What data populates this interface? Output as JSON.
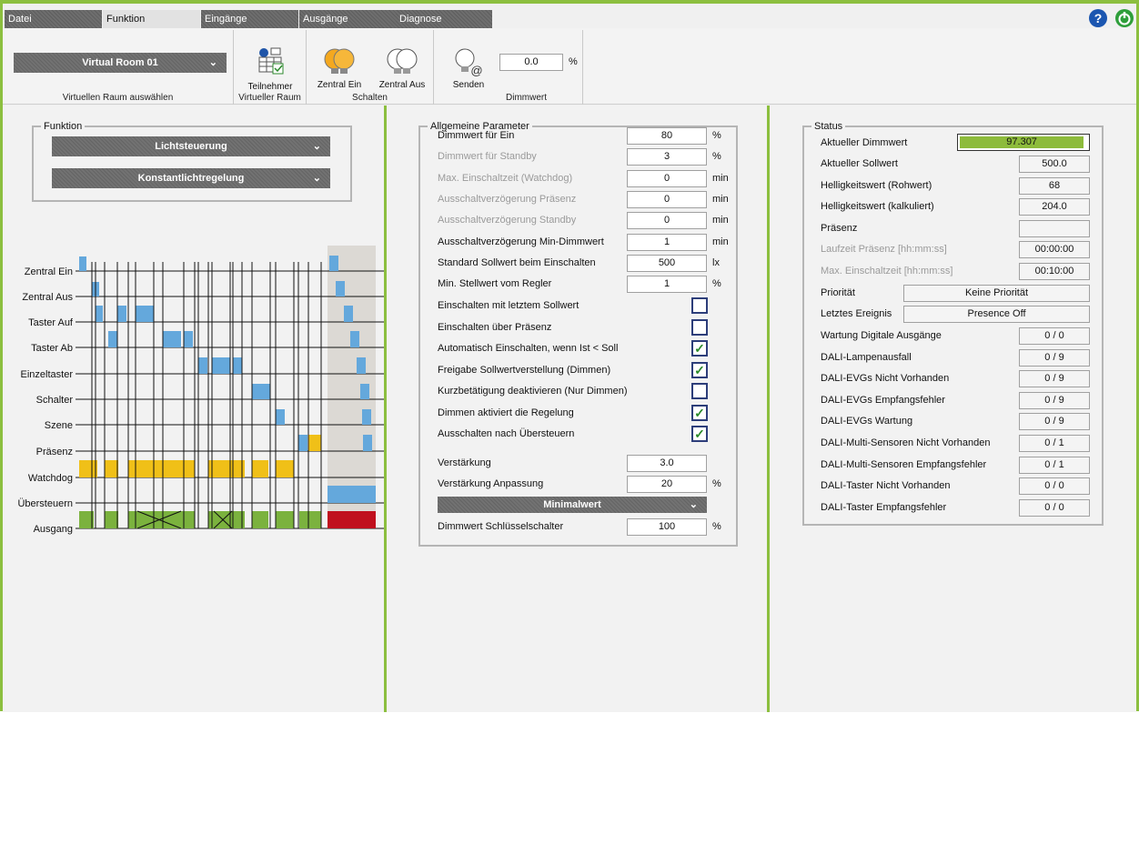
{
  "tabs": [
    "Datei",
    "Funktion",
    "Eingänge",
    "Ausgänge",
    "Diagnose"
  ],
  "ribbon": {
    "room_select": "Virtual Room 01",
    "room_label": "Virtuellen Raum auswählen",
    "participants_btn": "Teilnehmer",
    "participants_label": "Virtueller Raum",
    "central_on": "Zentral Ein",
    "central_off": "Zentral Aus",
    "switch_label": "Schalten",
    "send": "Senden",
    "dim_value": "0.0",
    "dim_unit": "%",
    "dim_label": "Dimmwert"
  },
  "funktion": {
    "legend": "Funktion",
    "select1": "Lichtsteuerung",
    "select2": "Konstantlichtregelung"
  },
  "timeline": {
    "rows": [
      "Zentral Ein",
      "Zentral Aus",
      "Taster Auf",
      "Taster Ab",
      "Einzeltaster",
      "Schalter",
      "Szene",
      "Präsenz",
      "Watchdog",
      "Übersteuern",
      "Ausgang"
    ]
  },
  "params": {
    "legend": "Allgemeine Parameter",
    "fields": [
      {
        "label": "Dimmwert für Ein",
        "value": "80",
        "unit": "%"
      },
      {
        "label": "Dimmwert für Standby",
        "value": "3",
        "unit": "%"
      },
      {
        "label": "Max. Einschaltzeit (Watchdog)",
        "value": "0",
        "unit": "min"
      },
      {
        "label": "Ausschaltverzögerung Präsenz",
        "value": "0",
        "unit": "min"
      },
      {
        "label": "Ausschaltverzögerung Standby",
        "value": "0",
        "unit": "min"
      },
      {
        "label": "Ausschaltverzögerung Min-Dimmwert",
        "value": "1",
        "unit": "min"
      },
      {
        "label": "Standard Sollwert beim Einschalten",
        "value": "500",
        "unit": "lx"
      },
      {
        "label": "Min. Stellwert vom Regler",
        "value": "1",
        "unit": "%"
      }
    ],
    "checks": [
      {
        "label": "Einschalten mit letztem Sollwert",
        "checked": false
      },
      {
        "label": "Einschalten über Präsenz",
        "checked": false
      },
      {
        "label": "Automatisch Einschalten, wenn Ist < Soll",
        "checked": true
      },
      {
        "label": "Freigabe Sollwertverstellung (Dimmen)",
        "checked": true
      },
      {
        "label": "Kurzbetätigung deaktivieren (Nur Dimmen)",
        "checked": false
      },
      {
        "label": "Dimmen aktiviert die Regelung",
        "checked": true
      },
      {
        "label": "Ausschalten nach Übersteuern",
        "checked": true
      }
    ],
    "gain_label": "Verstärkung",
    "gain_value": "3.0",
    "gain_adj_label": "Verstärkung Anpassung",
    "gain_adj_value": "20",
    "gain_adj_unit": "%",
    "min_select": "Minimalwert",
    "key_label": "Dimmwert Schlüsselschalter",
    "key_value": "100",
    "key_unit": "%"
  },
  "status": {
    "legend": "Status",
    "current_dim_label": "Aktueller Dimmwert",
    "current_dim_value": "97.307",
    "current_dim_fraction": 0.97307,
    "rows": [
      {
        "label": "Aktueller Sollwert",
        "value": "500.0",
        "dim": false
      },
      {
        "label": "Helligkeitswert (Rohwert)",
        "value": "68",
        "dim": false
      },
      {
        "label": "Helligkeitswert (kalkuliert)",
        "value": "204.0",
        "dim": false
      },
      {
        "label": "Präsenz",
        "value": "",
        "dim": false
      },
      {
        "label": "Laufzeit Präsenz [hh:mm:ss]",
        "value": "00:00:00",
        "dim": true
      },
      {
        "label": "Max. Einschaltzeit [hh:mm:ss]",
        "value": "00:10:00",
        "dim": true
      }
    ],
    "priority_label": "Priorität",
    "priority_value": "Keine Priorität",
    "event_label": "Letztes Ereignis",
    "event_value": "Presence Off",
    "rows2": [
      {
        "label": "Wartung Digitale Ausgänge",
        "value": "0 / 0"
      },
      {
        "label": "DALI-Lampenausfall",
        "value": "0 / 9"
      },
      {
        "label": "DALI-EVGs Nicht Vorhanden",
        "value": "0 / 9"
      },
      {
        "label": "DALI-EVGs Empfangsfehler",
        "value": "0 / 9"
      },
      {
        "label": "DALI-EVGs Wartung",
        "value": "0 / 9"
      },
      {
        "label": "DALI-Multi-Sensoren Nicht Vorhanden",
        "value": "0 / 1"
      },
      {
        "label": "DALI-Multi-Sensoren Empfangsfehler",
        "value": "0 / 1"
      },
      {
        "label": "DALI-Taster Nicht Vorhanden",
        "value": "0 / 0"
      },
      {
        "label": "DALI-Taster Empfangsfehler",
        "value": "0 / 0"
      }
    ]
  },
  "icons": [
    "help-icon",
    "power-icon",
    "participants-icon",
    "bulb-on-icon",
    "bulb-off-icon",
    "bulb-send-icon"
  ],
  "colors": {
    "accent": "#8cbf3f",
    "bar_blue": "#64a8dc",
    "bar_yellow": "#f0c018",
    "bar_green": "#7bb23e",
    "bar_red": "#c0101e"
  }
}
